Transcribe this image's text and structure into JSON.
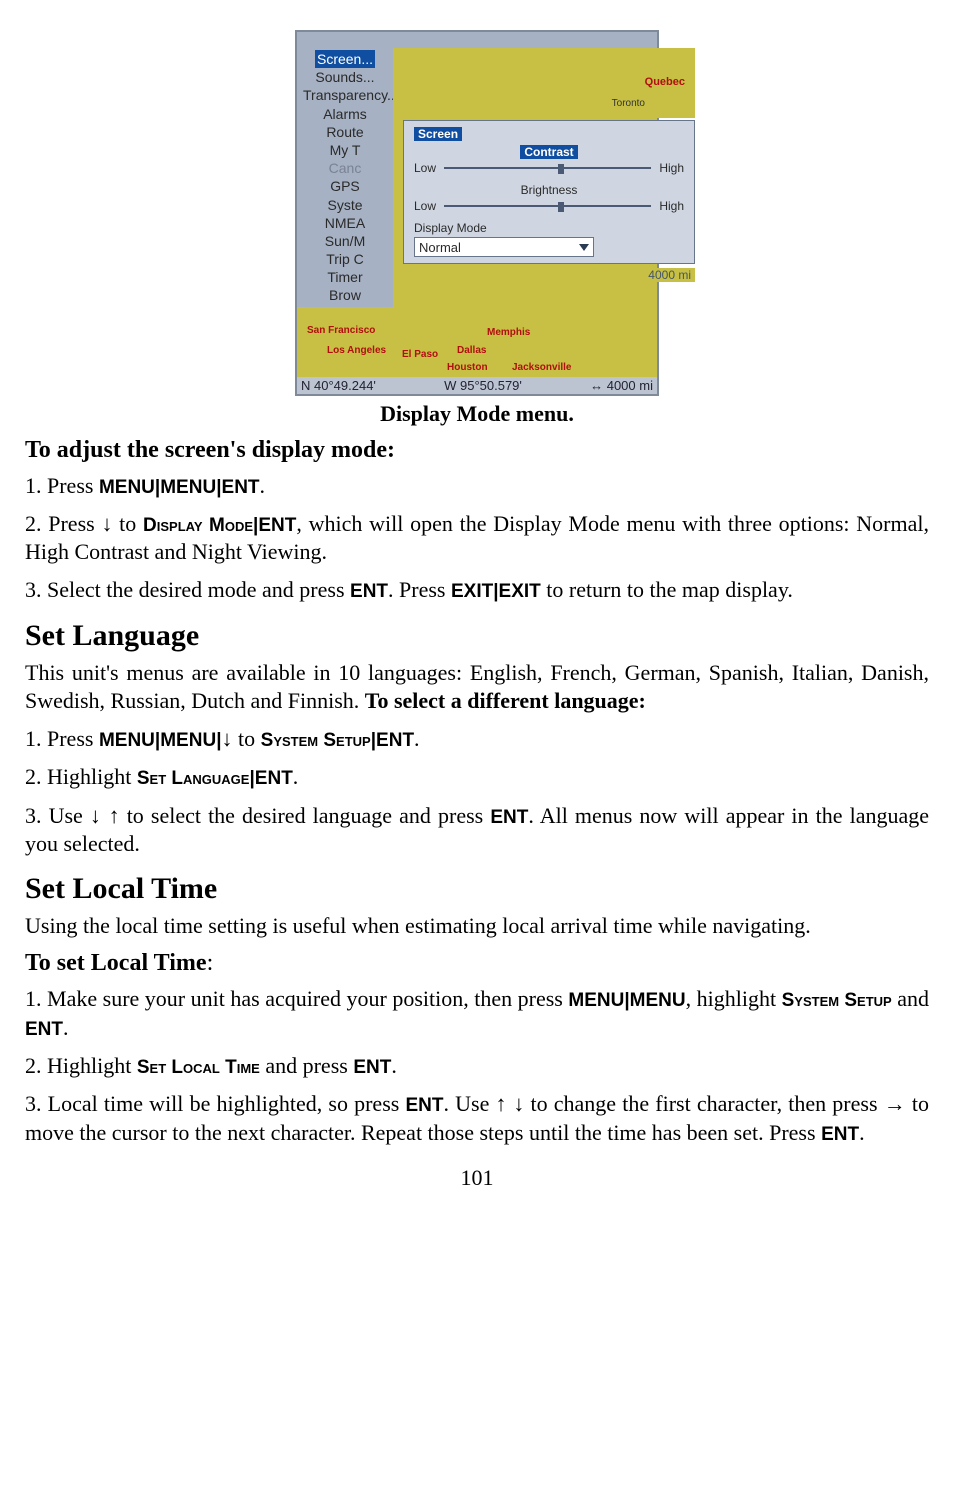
{
  "figure": {
    "menu": {
      "items": [
        {
          "label": "Screen..."
        },
        {
          "label": "Sounds..."
        },
        {
          "label": "Transparency..."
        },
        {
          "label": "Alarms"
        },
        {
          "label": "Route"
        },
        {
          "label": "My T"
        },
        {
          "label": "Canc"
        },
        {
          "label": "GPS"
        },
        {
          "label": "Syste"
        },
        {
          "label": "NMEA"
        },
        {
          "label": "Sun/M"
        },
        {
          "label": "Trip C"
        },
        {
          "label": "Timer"
        },
        {
          "label": "Brow"
        }
      ],
      "overlay": {
        "title": "Screen",
        "contrast": {
          "label": "Contrast",
          "low": "Low",
          "high": "High"
        },
        "brightness": {
          "label": "Brightness",
          "low": "Low",
          "high": "High"
        },
        "display_mode": {
          "label": "Display Mode",
          "value": "Normal"
        }
      },
      "map_labels": [
        "San Francisco",
        "Los Angeles",
        "El Paso",
        "Dallas",
        "Memphis",
        "Houston",
        "Jacksonville",
        "Quebec",
        "Toronto"
      ],
      "scale_right": "4000 mi",
      "scale_bottom": "4000 mi",
      "coords": {
        "left": "N   40°49.244'",
        "mid": "W   95°50.579'",
        "right": "↔ 4000 mi"
      }
    },
    "caption": "Display Mode menu."
  },
  "sections": {
    "adjust_display": {
      "title": "To adjust the screen's display mode:",
      "s1_a": "1. Press ",
      "s1_b": "MENU",
      "s1_c": "|",
      "s1_d": "MENU",
      "s1_e": "|",
      "s1_f": "ENT",
      "s1_g": ".",
      "s2_a": "2. Press ",
      "s2_b": "↓",
      "s2_c": " to ",
      "s2_d": "Display Mode",
      "s2_e": "|",
      "s2_f": "ENT",
      "s2_g": ", which will open the Display Mode menu with three options: Normal, High Contrast and Night Viewing.",
      "s3_a": "3. Select the desired mode and press ",
      "s3_b": "ENT",
      "s3_c": ". Press ",
      "s3_d": "EXIT",
      "s3_e": "|",
      "s3_f": "EXIT",
      "s3_g": " to return to the map display."
    },
    "set_language": {
      "title": "Set Language",
      "p_a": "This unit's menus are available in 10 languages: English, French, German, Spanish, Italian, Danish, Swedish, Russian, Dutch and Finnish. ",
      "sub": "To select a different language:",
      "s1_a": "1. Press ",
      "s1_b": "MENU",
      "s1_c": "|",
      "s1_d": "MENU",
      "s1_e": "|",
      "s1_f": "↓",
      "s1_g": " to ",
      "s1_h": "System Setup",
      "s1_i": "|",
      "s1_j": "ENT",
      "s1_k": ".",
      "s2_a": "2. Highlight ",
      "s2_b": "Set Language",
      "s2_c": "|",
      "s2_d": "ENT",
      "s2_e": ".",
      "s3_a": "3. Use ",
      "s3_b": "↓ ↑",
      "s3_c": " to select the desired language and press ",
      "s3_d": "ENT",
      "s3_e": ". All menus now will appear in the language you selected."
    },
    "set_local_time": {
      "title": "Set Local Time",
      "p": "Using the local time setting is useful when estimating local arrival time while navigating.",
      "sub": "To set Local Time",
      "sub_colon": ":",
      "s1_a": "1. Make sure your unit has acquired your position, then press ",
      "s1_b": "MENU",
      "s1_c": "|",
      "s1_d": "MENU",
      "s1_e": ", highlight ",
      "s1_f": "System Setup",
      "s1_g": " and ",
      "s1_h": "ENT",
      "s1_i": ".",
      "s2_a": "2. Highlight ",
      "s2_b": "Set Local Time",
      "s2_c": " and press ",
      "s2_d": "ENT",
      "s2_e": ".",
      "s3_a": "3. Local time will be highlighted, so press ",
      "s3_b": "ENT",
      "s3_c": ". Use ",
      "s3_d": "↑ ↓",
      "s3_e": "  to change the first character, then press ",
      "s3_f": "→",
      "s3_g": " to move the cursor to the next character. Repeat those steps until the time has been set. Press ",
      "s3_h": "ENT",
      "s3_i": "."
    }
  },
  "page_number": "101"
}
